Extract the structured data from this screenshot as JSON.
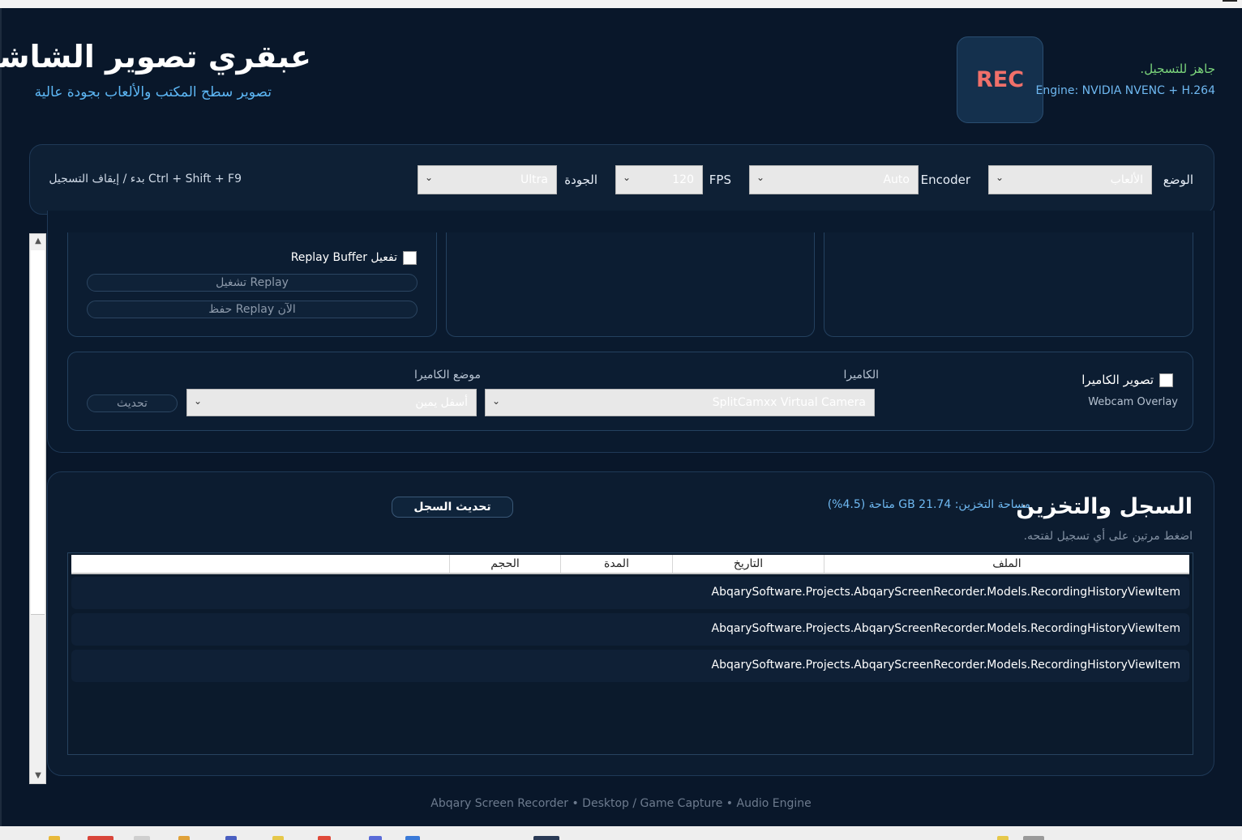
{
  "header": {
    "title": "عبقري تصوير الشاشة",
    "subtitle": "تصوير سطح المكتب والألعاب بجودة عالية",
    "rec_label": "REC",
    "status": "جاهز للتسجيل.",
    "engine": "Engine: NVIDIA NVENC + H.264"
  },
  "toolbar": {
    "mode_label": "الوضع",
    "mode_value": "الألعاب",
    "encoder_label": "Encoder",
    "encoder_value": "Auto",
    "fps_label": "FPS",
    "fps_value": "120",
    "quality_label": "الجودة",
    "quality_value": "Ultra",
    "hotkey": "Ctrl + Shift + F9  بدء / إيقاف التسجيل"
  },
  "replay": {
    "enable_label": "تفعيل Replay Buffer",
    "run_button": "تشغيل Replay",
    "save_button": "حفظ Replay الآن"
  },
  "camera": {
    "enable_label": "تصوير الكاميرا",
    "overlay_caption": "Webcam Overlay",
    "camera_label": "الكاميرا",
    "camera_value": "SplitCamxx Virtual Camera",
    "position_label": "موضع الكاميرا",
    "position_value": "أسفل يمين",
    "refresh_button": "تحديث"
  },
  "history": {
    "title": "السجل والتخزين",
    "storage": "مساحة التخزين: 21.74 GB متاحة (4.5%)",
    "hint": "اضغط مرتين على أي تسجيل لفتحه.",
    "refresh_button": "تحديث السجل",
    "columns": [
      "الملف",
      "التاريخ",
      "المدة",
      "الحجم"
    ],
    "rows": [
      "AbqarySoftware.Projects.AbqaryScreenRecorder.Models.RecordingHistoryViewItem",
      "AbqarySoftware.Projects.AbqaryScreenRecorder.Models.RecordingHistoryViewItem",
      "AbqarySoftware.Projects.AbqaryScreenRecorder.Models.RecordingHistoryViewItem"
    ]
  },
  "footer": "Abqary Screen Recorder • Desktop / Game Capture • Audio Engine",
  "colors": {
    "background": "#09172a",
    "accent_blue": "#5db7f5",
    "rec_red": "#f0706a",
    "status_green": "#7cd67c"
  }
}
